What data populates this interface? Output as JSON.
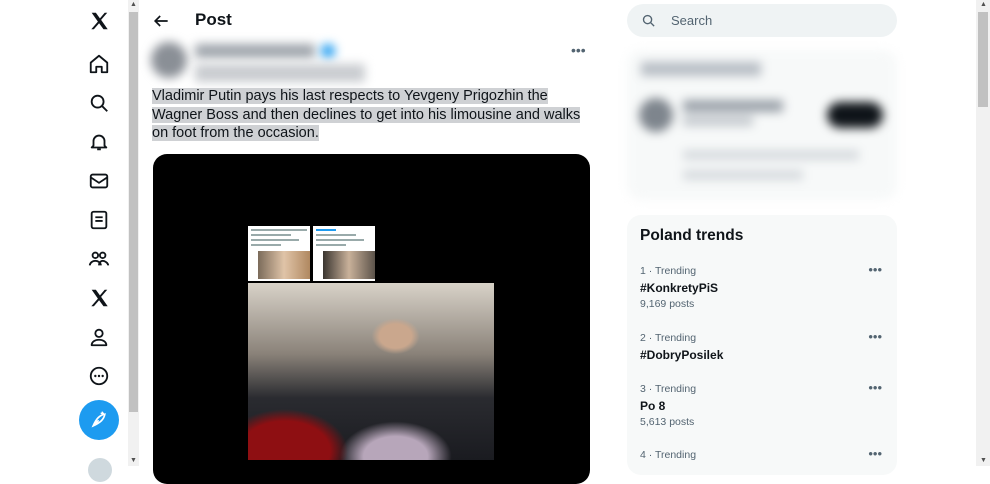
{
  "header": {
    "title": "Post"
  },
  "post": {
    "text": "Vladimir Putin pays his last respects to Yevgeny Prigozhin the Wagner Boss and then declines to get into his limousine and walks on foot from the occasion.",
    "more_icon": "more-horizontal-icon"
  },
  "nav": {
    "icons": [
      "x-logo-icon",
      "home-icon",
      "search-icon",
      "bell-icon",
      "mail-icon",
      "lists-icon",
      "communities-icon",
      "x-premium-icon",
      "profile-icon",
      "more-circle-icon",
      "compose-icon"
    ]
  },
  "search": {
    "placeholder": "Search"
  },
  "trends": {
    "title": "Poland trends",
    "items": [
      {
        "meta": "1 · Trending",
        "name": "#KonkretyPiS",
        "count": "9,169 posts"
      },
      {
        "meta": "2 · Trending",
        "name": "#DobryPosilek",
        "count": ""
      },
      {
        "meta": "3 · Trending",
        "name": "Po 8",
        "count": "5,613 posts"
      },
      {
        "meta": "4 · Trending",
        "name": "",
        "count": ""
      }
    ]
  },
  "colors": {
    "accent": "#1d9bf0",
    "text": "#0f1419",
    "secondary": "#536471",
    "panel": "#f7f9f9"
  }
}
